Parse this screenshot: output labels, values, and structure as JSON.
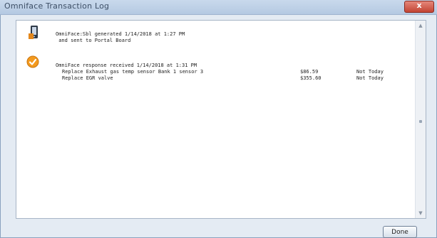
{
  "window": {
    "title": "Omniface Transaction Log",
    "close_glyph": "x"
  },
  "log": {
    "generated_line1": "OmniFace:Sbl generated 1/14/2018 at 1:27 PM",
    "generated_line2": " and sent to Portal Board",
    "response_line": "OmniFace response received 1/14/2018 at 1:31 PM",
    "items": [
      {
        "description": "Replace Exhaust gas temp sensor Bank 1 sensor 3",
        "price": "$86.59",
        "status": "Not Today"
      },
      {
        "description": "Replace EGR valve",
        "price": "$355.60",
        "status": "Not Today"
      }
    ]
  },
  "buttons": {
    "done": "Done"
  },
  "colors": {
    "accent_check": "#f39a1e",
    "panel_bg": "#ffffff",
    "window_bg": "#e4ebf3"
  },
  "icons": {
    "generated": "document-phone-icon",
    "response": "check-circle-icon"
  }
}
